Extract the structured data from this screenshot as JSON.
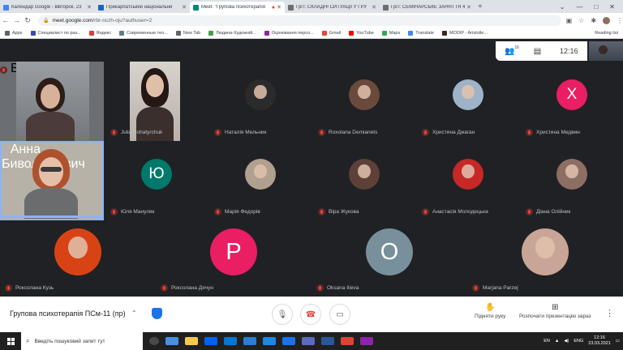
{
  "browser": {
    "tabs": [
      {
        "label": "Календар Google - вівторок, 23",
        "color": "#4285f4",
        "active": false
      },
      {
        "label": "Прикарпатський національни",
        "color": "#1565c0",
        "active": false
      },
      {
        "label": "Meet: \"Групова психотерапія",
        "color": "#00897b",
        "active": true
      },
      {
        "label": "ГрП: СКЛАДНІ СИТУАЦІЇ У ГРУ",
        "color": "#6d6d6d",
        "active": false
      },
      {
        "label": "ГрП: СЕМІНАРСЬКЕ ЗАНЯТТЯ 4",
        "color": "#6d6d6d",
        "active": false
      }
    ],
    "new_tab": "+",
    "url_host": "meet.google.com",
    "url_path": "/rbr-nczh-oju?authuser=2",
    "bookmarks": [
      {
        "label": "Apps",
        "color": "#5f6368"
      },
      {
        "label": "Специалист по раз...",
        "color": "#3949ab"
      },
      {
        "label": "Яндекс",
        "color": "#e53935"
      },
      {
        "label": "Современные тео...",
        "color": "#607d8b"
      },
      {
        "label": "New Tab",
        "color": "#5f6368"
      },
      {
        "label": "Людина-Художній...",
        "color": "#43a047"
      },
      {
        "label": "Оцінювання персо...",
        "color": "#8e24aa"
      },
      {
        "label": "Gmail",
        "color": "#ea4335"
      },
      {
        "label": "YouTube",
        "color": "#ff0000"
      },
      {
        "label": "Maps",
        "color": "#34a853"
      },
      {
        "label": "Translate",
        "color": "#4285f4"
      },
      {
        "label": "MODIP - Aristotle...",
        "color": "#3e2723"
      }
    ],
    "reading_list": "Reading list"
  },
  "meet": {
    "participant_count": "16",
    "time": "12:16",
    "meeting_title": "Групова психотерапія ПСм-11 (пр)",
    "raise_hand_label": "Підняти руку",
    "present_label": "Розпочати презентацію зараз",
    "participants": [
      {
        "name": "Julia Bohatyrchuk",
        "kind": "video"
      },
      {
        "name": "Наталія Мельник",
        "kind": "photo",
        "color": "#2b2b2b"
      },
      {
        "name": "Roxolana Demianets",
        "kind": "photo",
        "color": "#6a4a3a"
      },
      {
        "name": "Христина Джаган",
        "kind": "photo",
        "color": "#9fb3c8"
      },
      {
        "name": "Христина Медвин",
        "kind": "letter",
        "letter": "Х",
        "color": "#e91e63"
      },
      {
        "name": "Юля Мануляк",
        "kind": "letter",
        "letter": "Ю",
        "color": "#00796b"
      },
      {
        "name": "Марія Федорів",
        "kind": "photo",
        "color": "#b0a090"
      },
      {
        "name": "Віра Жукова",
        "kind": "photo",
        "color": "#5d4037"
      },
      {
        "name": "Анастасія Молодецька",
        "kind": "photo",
        "color": "#c62828"
      },
      {
        "name": "Діана Олійник",
        "kind": "photo",
        "color": "#8d6e63"
      },
      {
        "name": "Роксолана Кузь",
        "kind": "photo",
        "color": "#d84315"
      },
      {
        "name": "Роксолана Дячун",
        "kind": "letter",
        "letter": "Р",
        "color": "#e91e63"
      },
      {
        "name": "Oksana Ilieva",
        "kind": "letter",
        "letter": "O",
        "color": "#78909c"
      },
      {
        "name": "Marjana Parzej",
        "kind": "photo",
        "color": "#c8a596"
      }
    ],
    "speaker_name": "Анна Бивольккевич",
    "top_video_name": "Ва"
  },
  "taskbar": {
    "search_placeholder": "Введіть пошуковий запит тут",
    "lang": "ENG",
    "lang2": "EN",
    "time": "12:16",
    "date": "23.03.2021"
  }
}
